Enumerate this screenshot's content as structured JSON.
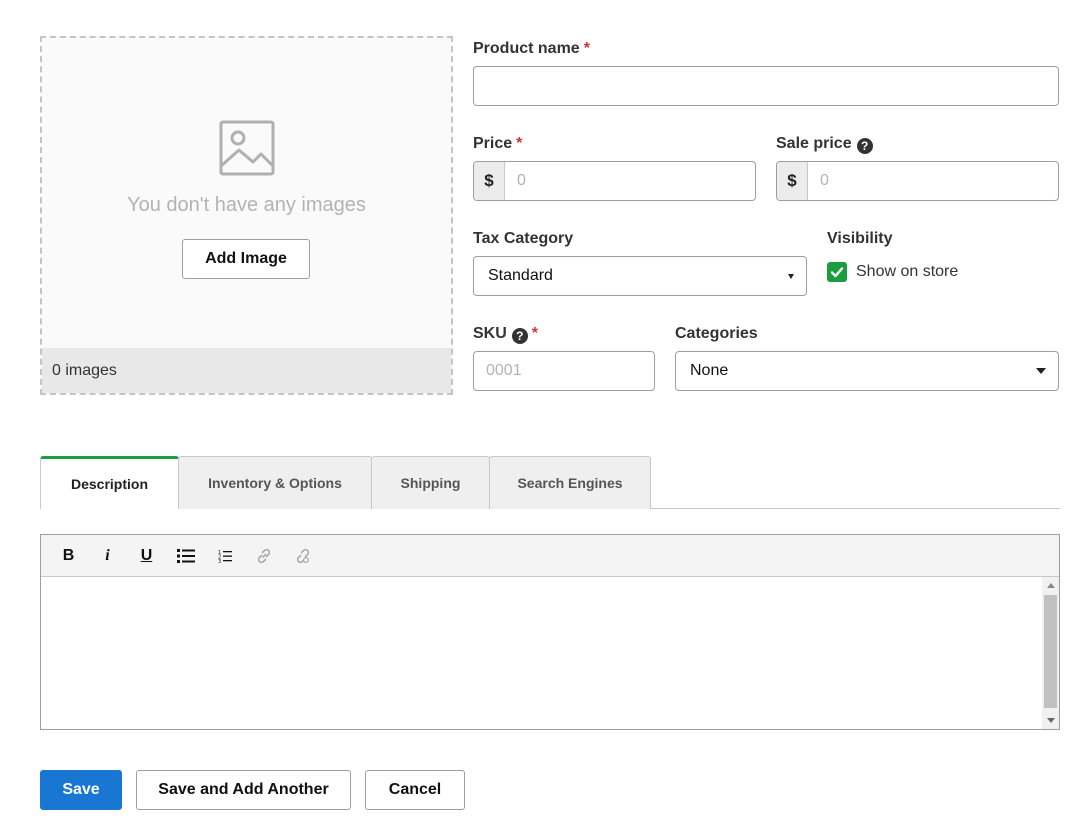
{
  "images": {
    "empty_text": "You don't have any images",
    "add_button": "Add Image",
    "count_text": "0 images"
  },
  "product_name": {
    "label": "Product name",
    "required_mark": "*",
    "value": ""
  },
  "price": {
    "label": "Price",
    "required_mark": "*",
    "prefix": "$",
    "placeholder": "0"
  },
  "sale_price": {
    "label": "Sale price",
    "help_glyph": "?",
    "prefix": "$",
    "placeholder": "0"
  },
  "tax_category": {
    "label": "Tax Category",
    "selected": "Standard"
  },
  "visibility": {
    "label": "Visibility",
    "checkbox_label": "Show on store",
    "checked": true
  },
  "sku": {
    "label": "SKU",
    "help_glyph": "?",
    "required_mark": "*",
    "placeholder": "0001"
  },
  "categories": {
    "label": "Categories",
    "selected": "None"
  },
  "tabs": [
    {
      "label": "Description",
      "active": true
    },
    {
      "label": "Inventory & Options",
      "active": false
    },
    {
      "label": "Shipping",
      "active": false
    },
    {
      "label": "Search Engines",
      "active": false
    }
  ],
  "editor": {
    "toolbar": [
      {
        "icon": "bold-icon",
        "glyph": "B"
      },
      {
        "icon": "italic-icon",
        "glyph": "i"
      },
      {
        "icon": "underline-icon",
        "glyph": "U"
      },
      {
        "icon": "bullet-list-icon"
      },
      {
        "icon": "numbered-list-icon"
      },
      {
        "icon": "link-icon",
        "disabled": true
      },
      {
        "icon": "unlink-icon",
        "disabled": true
      }
    ],
    "content": ""
  },
  "actions": {
    "save": "Save",
    "save_add_another": "Save and Add Another",
    "cancel": "Cancel"
  },
  "colors": {
    "accent_green": "#1a9e3f",
    "primary_blue": "#1976d2",
    "required_red": "#d0342c"
  }
}
